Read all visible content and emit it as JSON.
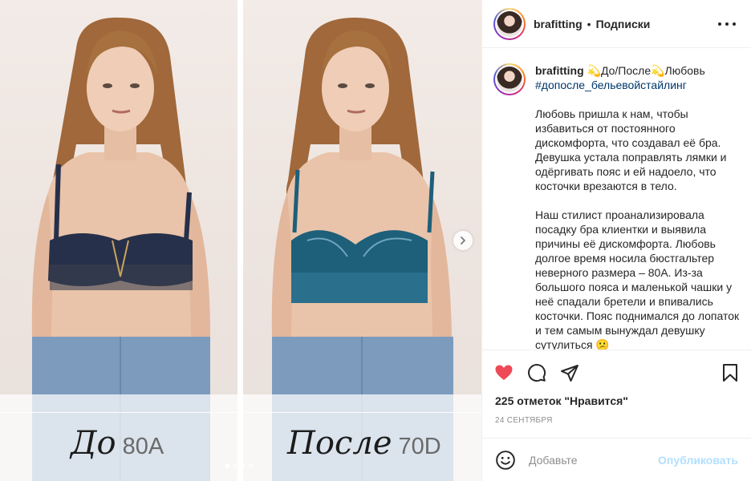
{
  "media": {
    "before": {
      "word": "До",
      "size": "80A"
    },
    "after": {
      "word": "После",
      "size": "70D"
    },
    "carousel_dots": 4,
    "active_dot": 1
  },
  "header": {
    "username": "brafitting",
    "separator": "•",
    "follow_label": "Подписки"
  },
  "caption": {
    "username": "brafitting",
    "title": "До/После",
    "title_tail": "Любовь",
    "spark_emoji": "💫",
    "hashtag": "#допосле_бельевойстайлинг",
    "paragraph1": "Любовь пришла к нам, чтобы избавиться от постоянного дискомфорта, что создавал её бра. Девушка устала поправлять лямки и одёргивать пояс и ей надоело, что косточки врезаются в тело.",
    "paragraph2": "Наш стилист проанализировала посадку бра клиентки и выявила причины её дискомфорта. Любовь долгое время носила бюстгальтер неверного размера – 80A. Из-за большого пояса и маленькой чашки у неё спадали бретели и впивались косточки. Пояс поднимался до лопаток и тем самым вынуждал девушку сутулиться 😕"
  },
  "engagement": {
    "likes": "225 отметок \"Нравится\"",
    "date": "24 сентября"
  },
  "add_comment": {
    "placeholder": "Добавьте",
    "publish_label": "Опубликовать"
  },
  "colors": {
    "like_red": "#ed4956",
    "link_blue": "#00376b",
    "publish_disabled": "#b2dffc",
    "bra_before": "#27304a",
    "bra_after": "#1e5f7a"
  },
  "icons": {
    "like": "heart-filled-icon",
    "comment": "comment-bubble-icon",
    "share": "paper-plane-icon",
    "save": "bookmark-icon",
    "emoji": "smiley-icon",
    "more": "ellipsis-icon",
    "next": "chevron-right-icon"
  }
}
